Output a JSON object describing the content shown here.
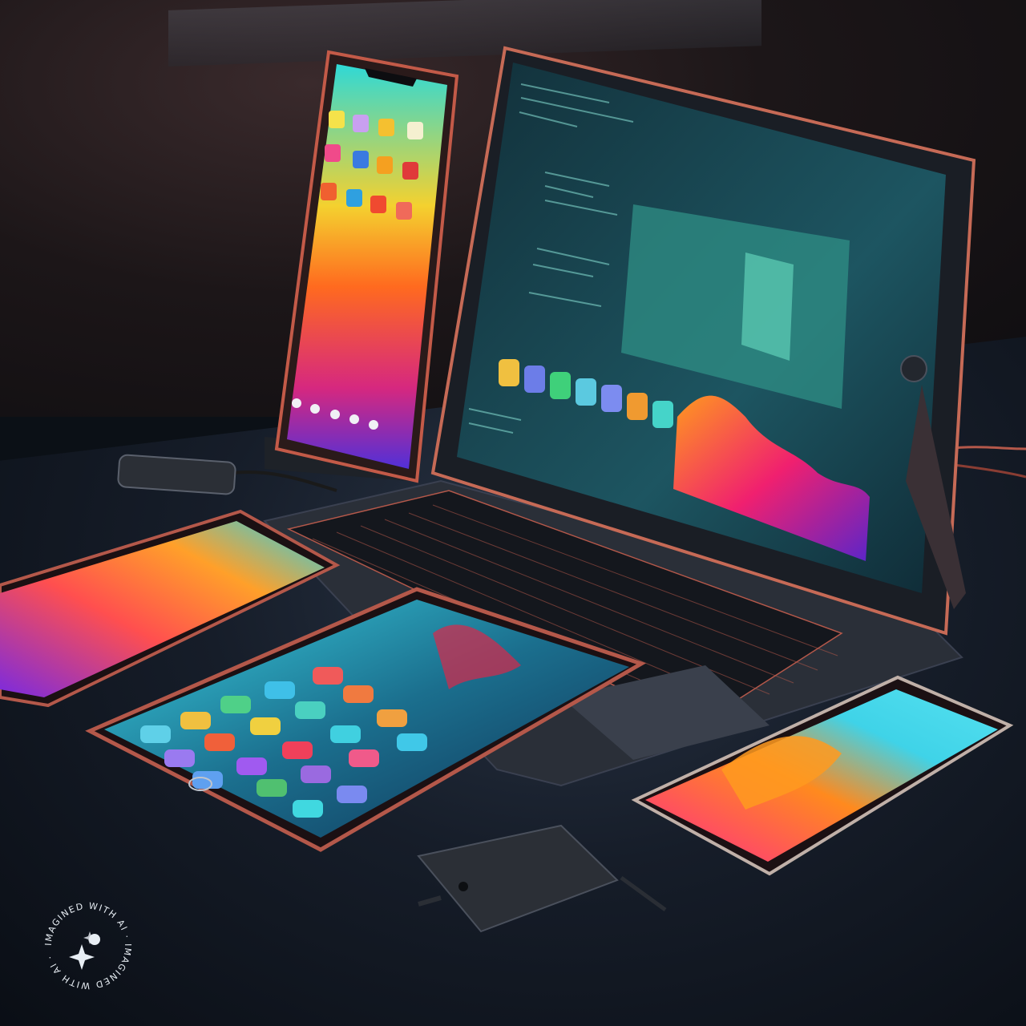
{
  "watermark": {
    "text": "IMAGINED WITH AI · IMAGINED WITH AI ·",
    "icon": "sparkle-icon"
  },
  "colors": {
    "table": "#131a25",
    "accent_copper": "#b4584a",
    "screen_teal": "#1e5a66",
    "wave_orange": "#ff7a1a",
    "wave_magenta": "#d9237a",
    "wave_violet": "#5b2fd1"
  }
}
